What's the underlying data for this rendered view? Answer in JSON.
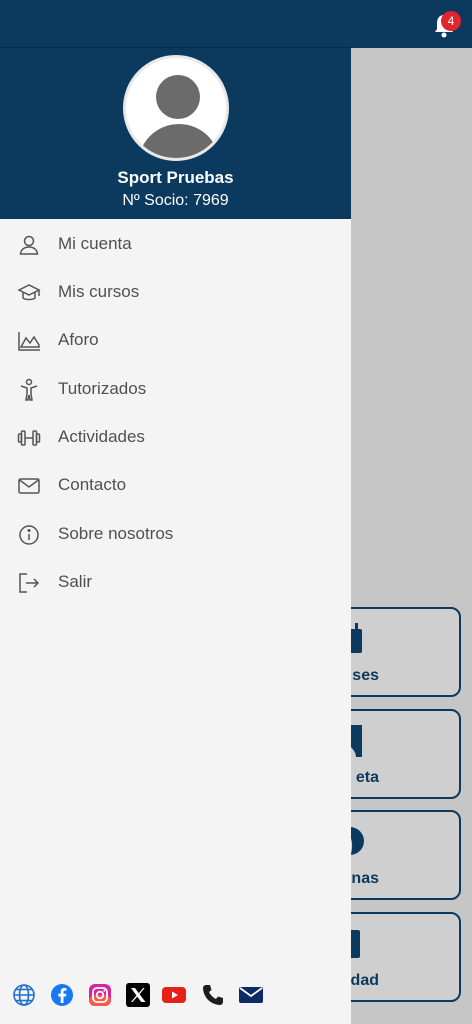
{
  "topbar": {
    "notification_count": "4"
  },
  "profile": {
    "name": "Sport Pruebas",
    "member_number": "Nº Socio: 7969"
  },
  "menu": [
    {
      "label": "Mi cuenta",
      "icon": "user-icon"
    },
    {
      "label": "Mis cursos",
      "icon": "graduation-cap-icon"
    },
    {
      "label": "Aforo",
      "icon": "area-chart-icon"
    },
    {
      "label": "Tutorizados",
      "icon": "person-icon"
    },
    {
      "label": "Actividades",
      "icon": "dumbbell-icon"
    },
    {
      "label": "Contacto",
      "icon": "envelope-icon"
    },
    {
      "label": "Sobre nosotros",
      "icon": "info-icon"
    },
    {
      "label": "Salir",
      "icon": "logout-icon"
    }
  ],
  "background_cards": [
    {
      "label": "ses"
    },
    {
      "label": "eta"
    },
    {
      "label": "nas"
    },
    {
      "label": "lidad"
    }
  ],
  "social": [
    "web-icon",
    "facebook-icon",
    "instagram-icon",
    "x-icon",
    "youtube-icon",
    "phone-icon",
    "mail-icon"
  ],
  "colors": {
    "primary": "#0b3a5e",
    "drawer_bg": "#f4f4f4",
    "badge": "#e0262f",
    "menu_text": "#505050"
  }
}
